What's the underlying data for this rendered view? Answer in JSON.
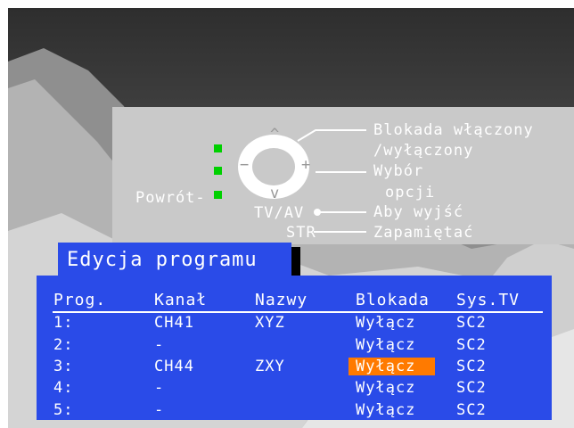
{
  "help": {
    "lock_line1": "Blokada włączony",
    "lock_line2": "/wyłączony",
    "select_line1": "Wybór",
    "select_line2": "opcji",
    "exit_label": "Aby wyjść",
    "save_label": "Zapamiętać",
    "back_label": "Powrót-",
    "tvav_label": "TV/AV",
    "str_label": "STR",
    "up_symbol": "^",
    "down_symbol": "v",
    "minus_symbol": "−",
    "plus_symbol": "+"
  },
  "title": "Edycja programu",
  "table": {
    "headers": [
      "Prog.",
      "Kanał",
      "Nazwy",
      "Blokada",
      "Sys.TV"
    ],
    "rows": [
      {
        "prog": "1:",
        "kanal": "CH41",
        "nazwy": "XYZ",
        "blokada": "Wyłącz",
        "system": "SC2"
      },
      {
        "prog": "2:",
        "kanal": "-",
        "nazwy": "",
        "blokada": "Wyłącz",
        "system": "SC2"
      },
      {
        "prog": "3:",
        "kanal": "CH44",
        "nazwy": "ZXY",
        "blokada": "Wyłącz",
        "system": "SC2"
      },
      {
        "prog": "4:",
        "kanal": "-",
        "nazwy": "",
        "blokada": "Wyłącz",
        "system": "SC2"
      },
      {
        "prog": "5:",
        "kanal": "-",
        "nazwy": "",
        "blokada": "Wyłącz",
        "system": "SC2"
      }
    ],
    "selected_row": 3
  },
  "colors": {
    "panel_blue": "#2a4be8",
    "highlight_orange": "#ff7a00",
    "indicator_green": "#00d000",
    "help_panel_gray": "#c9c9c9"
  }
}
